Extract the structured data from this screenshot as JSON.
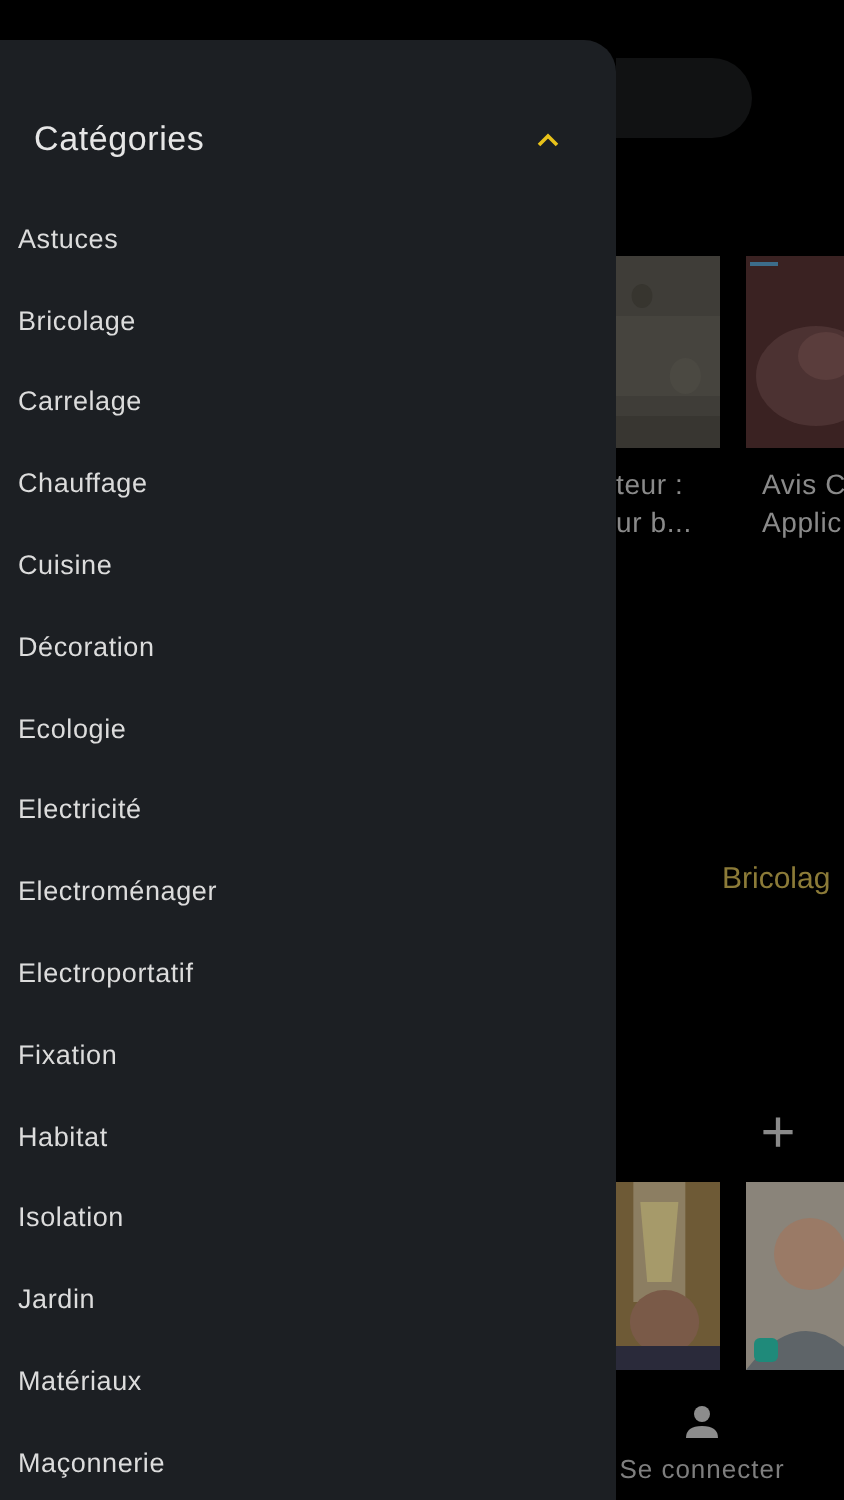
{
  "background_page": {
    "row_1": [
      {
        "kind": "picture",
        "caption": [
          "teur :",
          "ur b..."
        ]
      },
      {
        "kind": "picture",
        "caption": [
          "Avis C",
          "Applic"
        ]
      }
    ],
    "section_title": "Bricolag",
    "add_symbol": "+",
    "bottom_tab": {
      "label": "Se connecter"
    }
  },
  "drawer": {
    "title": "Catégories",
    "expanded": true,
    "items": [
      "Astuces",
      "Bricolage",
      "Carrelage",
      "Chauffage",
      "Cuisine",
      "Décoration",
      "Ecologie",
      "Electricité",
      "Electroménager",
      "Electroportatif",
      "Fixation",
      "Habitat",
      "Isolation",
      "Jardin",
      "Matériaux",
      "Maçonnerie"
    ]
  }
}
